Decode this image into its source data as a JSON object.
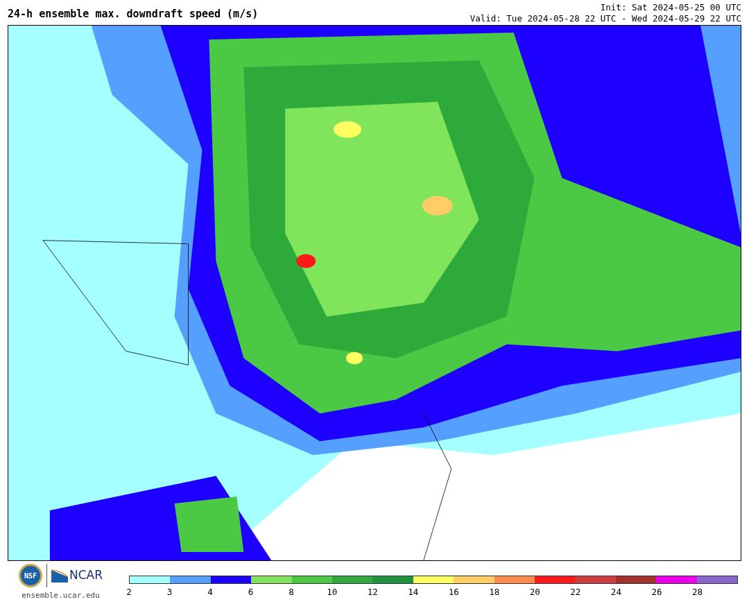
{
  "title": "24-h ensemble max. downdraft speed (m/s)",
  "init": "Init: Sat 2024-05-25 00 UTC",
  "valid": "Valid: Tue 2024-05-28 22 UTC - Wed 2024-05-29 22 UTC",
  "logos": {
    "left": "NSF",
    "right": "NCAR"
  },
  "site": "ensemble.ucar.edu",
  "colorbar": {
    "segments": [
      {
        "color": "#a6ffff"
      },
      {
        "color": "#55a0ff"
      },
      {
        "color": "#1e00ff"
      },
      {
        "color": "#80e55a"
      },
      {
        "color": "#4cc944"
      },
      {
        "color": "#2eaa3a"
      },
      {
        "color": "#1f9440"
      },
      {
        "color": "#ffff60"
      },
      {
        "color": "#ffcc66"
      },
      {
        "color": "#ff8c4c"
      },
      {
        "color": "#ff1a1a"
      },
      {
        "color": "#cc3f3f"
      },
      {
        "color": "#a32f2f"
      },
      {
        "color": "#ee00ee"
      },
      {
        "color": "#8866cc"
      }
    ],
    "ticks": [
      "2",
      "3",
      "4",
      "6",
      "8",
      "10",
      "12",
      "14",
      "16",
      "18",
      "20",
      "22",
      "24",
      "26",
      "28"
    ]
  }
}
